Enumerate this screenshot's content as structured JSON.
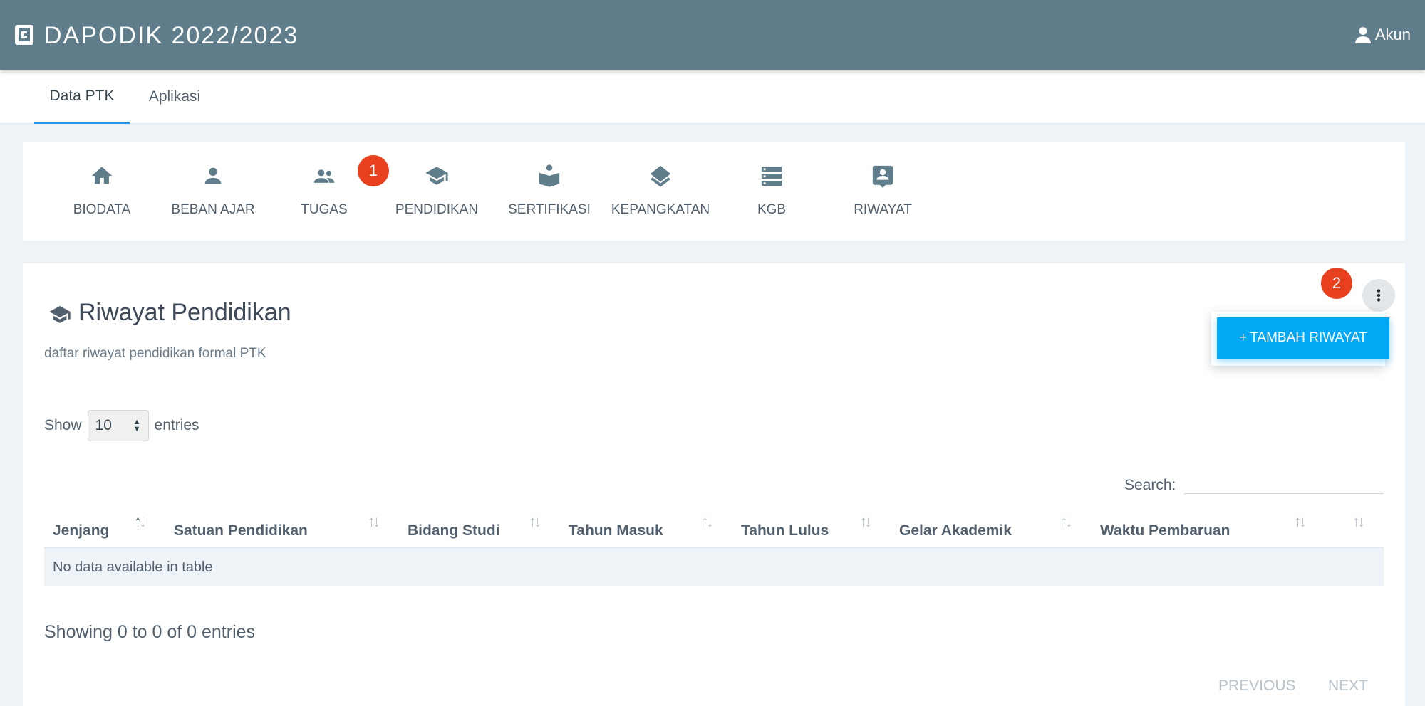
{
  "app": {
    "title": "DAPODIK 2022/2023",
    "account_label": "Akun"
  },
  "tabs": [
    {
      "label": "Data PTK"
    },
    {
      "label": "Aplikasi"
    }
  ],
  "nav": {
    "items": [
      {
        "label": "BIODATA",
        "icon": "home-icon"
      },
      {
        "label": "BEBAN AJAR",
        "icon": "person-icon"
      },
      {
        "label": "TUGAS",
        "icon": "people-icon"
      },
      {
        "label": "PENDIDIKAN",
        "icon": "graduation-cap-icon"
      },
      {
        "label": "SERTIFIKASI",
        "icon": "book-reader-icon"
      },
      {
        "label": "KEPANGKATAN",
        "icon": "layers-icon"
      },
      {
        "label": "KGB",
        "icon": "list-icon"
      },
      {
        "label": "RIWAYAT",
        "icon": "contact-card-icon"
      }
    ],
    "marker": "1"
  },
  "section": {
    "title": "Riwayat Pendidikan",
    "subtitle": "daftar riwayat pendidikan formal PTK",
    "menu_marker": "2",
    "add_button": "TAMBAH RIWAYAT"
  },
  "table": {
    "show_label": "Show",
    "page_size": "10",
    "entries_label": "entries",
    "search_label": "Search:",
    "search_value": "",
    "columns": [
      "Jenjang",
      "Satuan Pendidikan",
      "Bidang Studi",
      "Tahun Masuk",
      "Tahun Lulus",
      "Gelar Akademik",
      "Waktu Pembaruan",
      ""
    ],
    "empty_message": "No data available in table",
    "info": "Showing 0 to 0 of 0 entries",
    "previous_label": "PREVIOUS",
    "next_label": "NEXT"
  },
  "colors": {
    "topbar": "#607d8b",
    "accent": "#03a9f4",
    "tab_indicator": "#2196f3",
    "marker": "#e8401f"
  }
}
